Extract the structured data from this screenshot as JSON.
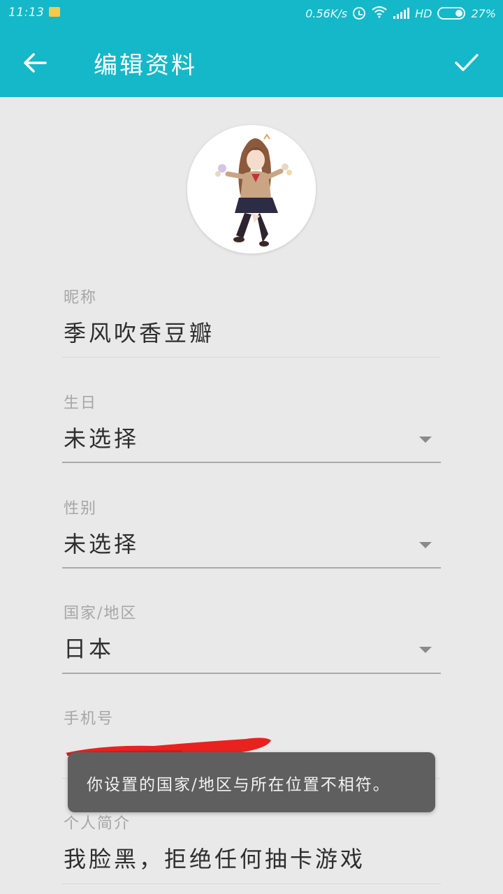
{
  "status_bar": {
    "time": "11:13",
    "network_speed": "0.56K/s",
    "network_type": "HD",
    "battery": "27%",
    "icons": [
      "notification-icon",
      "alarm-icon",
      "wifi-icon",
      "signal-icon",
      "battery-icon"
    ]
  },
  "toolbar": {
    "title": "编辑资料",
    "back_icon": "arrow-left-icon",
    "confirm_icon": "check-icon",
    "color": "#14b8c8"
  },
  "profile": {
    "avatar": "avatar-image",
    "fields": [
      {
        "label": "昵称",
        "value": "季风吹香豆瓣"
      },
      {
        "label": "生日",
        "value": "未选择",
        "dropdown": true
      },
      {
        "label": "性别",
        "value": "未选择",
        "dropdown": true
      },
      {
        "label": "国家/地区",
        "value": "日本",
        "dropdown": true
      },
      {
        "label": "手机号",
        "value": "",
        "redacted": true
      },
      {
        "label": "个人简介",
        "value": "我脸黑，拒绝任何抽卡游戏"
      }
    ]
  },
  "toast": {
    "message": "你设置的国家/地区与所在位置不相符。"
  }
}
